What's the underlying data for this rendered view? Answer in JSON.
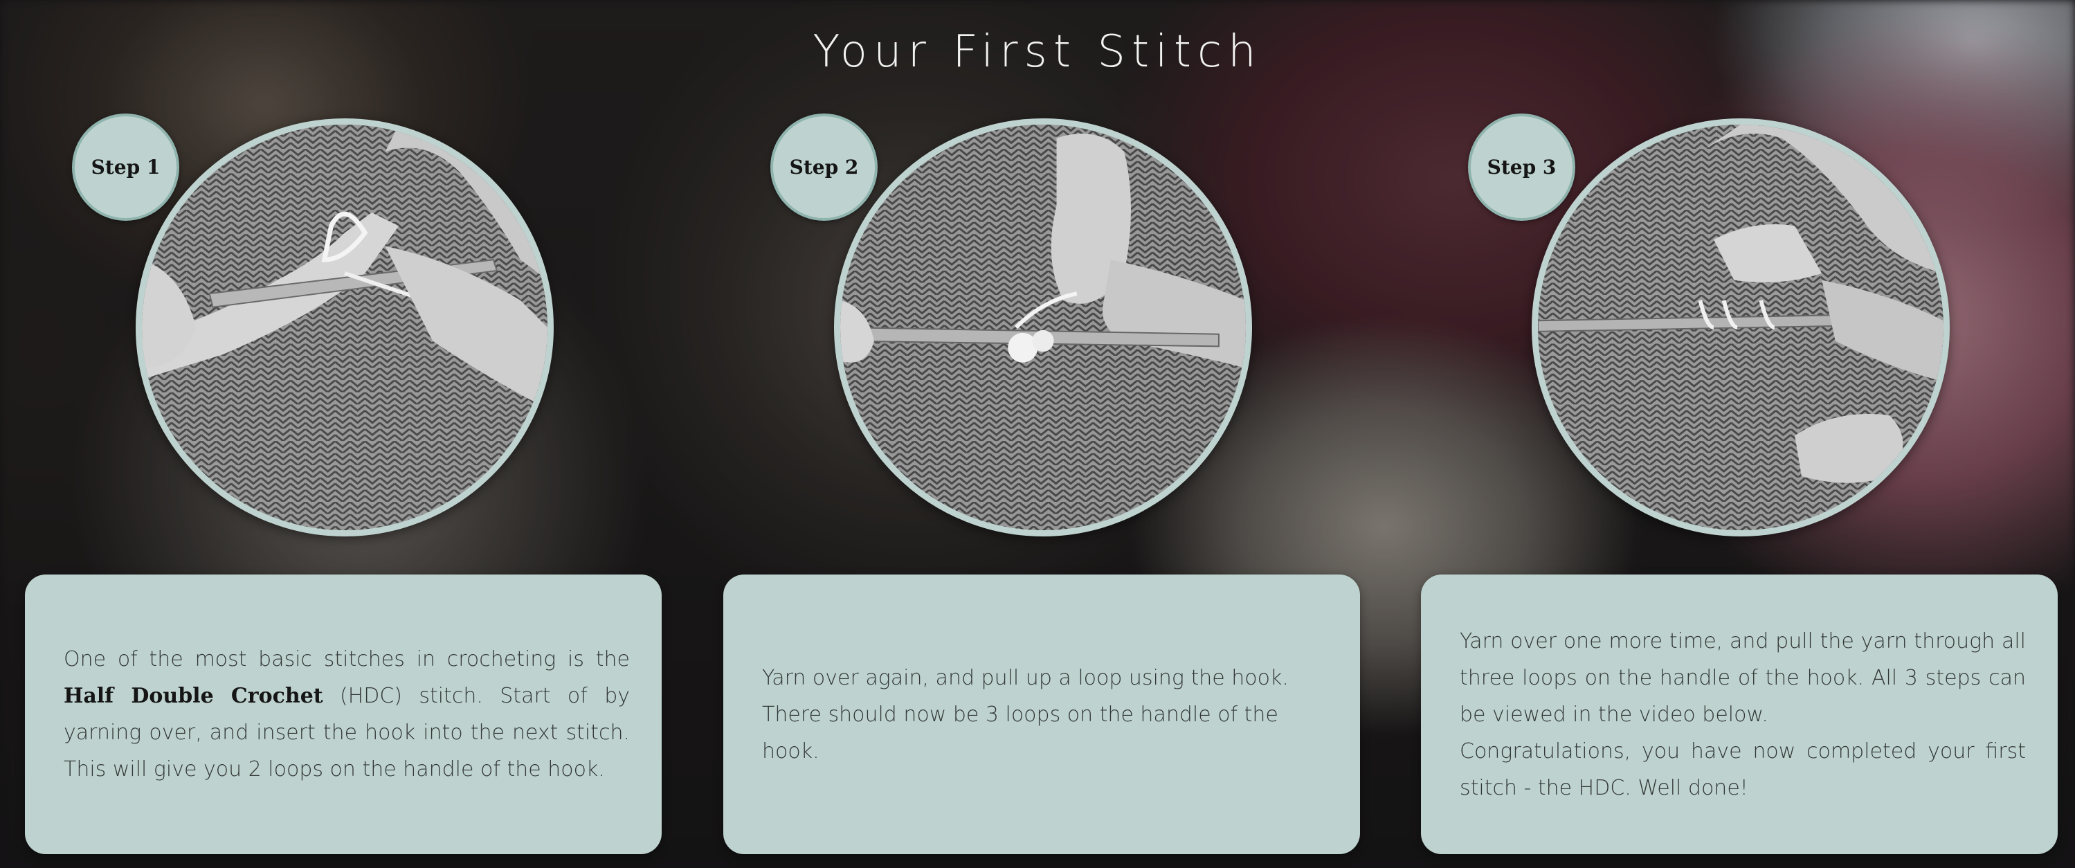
{
  "page": {
    "title": "Your First Stitch"
  },
  "steps": [
    {
      "badge": "Step 1",
      "image_alt": "Crochet hook with yarn over and hook inserted into stitch",
      "text_intro": "One of the most basic stitches in crocheting is the ",
      "text_bold": "Half Double Crochet",
      "text_rest": " (HDC) stitch. Start of by yarning over, and insert the hook into the next stitch. This will give you 2 loops on the handle of the hook."
    },
    {
      "badge": "Step 2",
      "image_alt": "Pulling up a loop using the hook, 3 loops on hook",
      "text": "Yarn over again, and pull up a loop using the hook. There should now be 3 loops on the handle of the hook."
    },
    {
      "badge": "Step 3",
      "image_alt": "Yarn over and pulling through all three loops",
      "text_line1": "Yarn over one more time, and pull the yarn through all three loops on the handle of the hook. All 3 steps can be viewed in the video below.",
      "text_line2": "Congratulations, you have now completed your first stitch - the HDC. Well done!"
    }
  ],
  "colors": {
    "accent": "#bed3cf",
    "badge_border": "#8fb3ad",
    "title": "#f2f2f2",
    "body_text": "#333837"
  }
}
